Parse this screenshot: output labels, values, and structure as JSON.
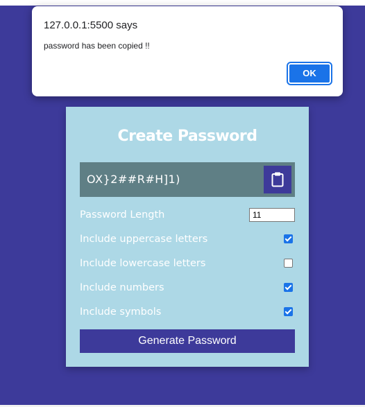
{
  "alert": {
    "origin": "127.0.0.1:5500 says",
    "message": "password has been copied !!",
    "ok_label": "OK"
  },
  "app": {
    "title": "Create Password",
    "password": "OX}2##R#H]1)",
    "clipboard_icon": "clipboard-icon",
    "length_label": "Password Length",
    "length_value": "11",
    "options": [
      {
        "label": "Include uppercase letters",
        "checked": true
      },
      {
        "label": "Include lowercase letters",
        "checked": false
      },
      {
        "label": "Include numbers",
        "checked": true
      },
      {
        "label": "Include symbols",
        "checked": true
      }
    ],
    "generate_label": "Generate Password"
  },
  "colors": {
    "background": "#3d3a9a",
    "card": "#add8e6",
    "result_box": "#5f7f85",
    "accent": "#1a73e8"
  }
}
